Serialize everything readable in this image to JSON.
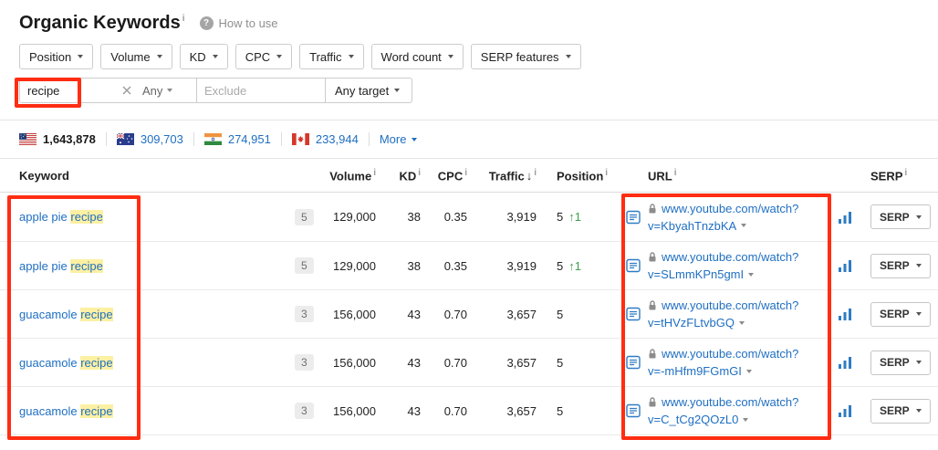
{
  "header": {
    "title": "Organic Keywords",
    "info": "i",
    "help_icon": "?",
    "how_to_use": "How to use"
  },
  "filters": {
    "buttons": [
      {
        "label": "Position"
      },
      {
        "label": "Volume"
      },
      {
        "label": "KD"
      },
      {
        "label": "CPC"
      },
      {
        "label": "Traffic"
      },
      {
        "label": "Word count"
      },
      {
        "label": "SERP features"
      }
    ],
    "include_value": "recipe",
    "match_any": "Any",
    "exclude_placeholder": "Exclude",
    "target": "Any target"
  },
  "countries": {
    "items": [
      {
        "country": "us",
        "value": "1,643,878"
      },
      {
        "country": "au",
        "value": "309,703"
      },
      {
        "country": "in",
        "value": "274,951"
      },
      {
        "country": "ca",
        "value": "233,944"
      }
    ],
    "more": "More"
  },
  "table": {
    "headers": {
      "keyword": "Keyword",
      "volume": "Volume",
      "kd": "KD",
      "cpc": "CPC",
      "traffic": "Traffic",
      "traffic_sort": "↓",
      "position": "Position",
      "url": "URL",
      "serp": "SERP",
      "info": "i"
    },
    "serp_button_label": "SERP",
    "rows": [
      {
        "keyword_prefix": "apple pie ",
        "keyword_highlight": "recipe",
        "badge": "5",
        "volume": "129,000",
        "kd": "38",
        "cpc": "0.35",
        "traffic": "3,919",
        "position": "5",
        "change": "↑1",
        "url_line1": "www.youtube.com/watch?",
        "url_line2": "v=KbyahTnzbKA"
      },
      {
        "keyword_prefix": "apple pie ",
        "keyword_highlight": "recipe",
        "badge": "5",
        "volume": "129,000",
        "kd": "38",
        "cpc": "0.35",
        "traffic": "3,919",
        "position": "5",
        "change": "↑1",
        "url_line1": "www.youtube.com/watch?",
        "url_line2": "v=SLmmKPn5gmI"
      },
      {
        "keyword_prefix": "guacamole ",
        "keyword_highlight": "recipe",
        "badge": "3",
        "volume": "156,000",
        "kd": "43",
        "cpc": "0.70",
        "traffic": "3,657",
        "position": "5",
        "change": "",
        "url_line1": "www.youtube.com/watch?",
        "url_line2": "v=tHVzFLtvbGQ"
      },
      {
        "keyword_prefix": "guacamole ",
        "keyword_highlight": "recipe",
        "badge": "3",
        "volume": "156,000",
        "kd": "43",
        "cpc": "0.70",
        "traffic": "3,657",
        "position": "5",
        "change": "",
        "url_line1": "www.youtube.com/watch?",
        "url_line2": "v=-mHfm9FGmGI"
      },
      {
        "keyword_prefix": "guacamole ",
        "keyword_highlight": "recipe",
        "badge": "3",
        "volume": "156,000",
        "kd": "43",
        "cpc": "0.70",
        "traffic": "3,657",
        "position": "5",
        "change": "",
        "url_line1": "www.youtube.com/watch?",
        "url_line2": "v=C_tCg2QOzL0"
      }
    ]
  },
  "colors": {
    "link_blue": "#1f6fc2",
    "highlight_yellow": "#fcf0a3",
    "positive_green": "#3f9e4d",
    "annotation_red": "#ff2d12"
  }
}
